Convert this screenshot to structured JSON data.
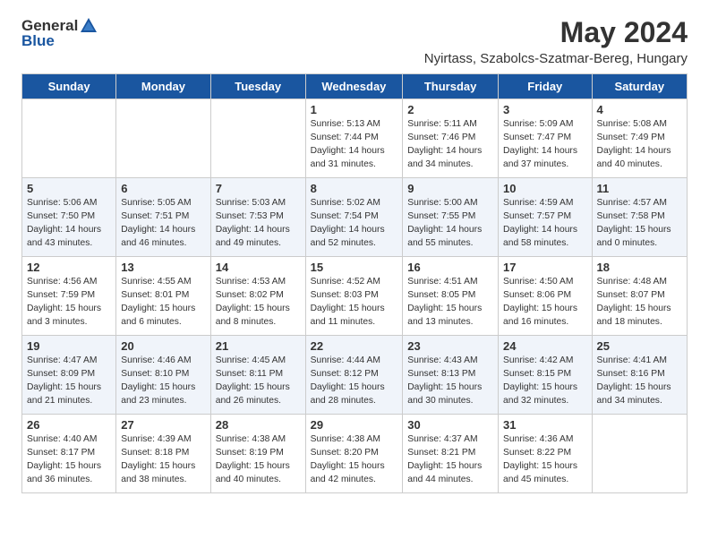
{
  "header": {
    "logo_general": "General",
    "logo_blue": "Blue",
    "month_year": "May 2024",
    "location": "Nyirtass, Szabolcs-Szatmar-Bereg, Hungary"
  },
  "days_of_week": [
    "Sunday",
    "Monday",
    "Tuesday",
    "Wednesday",
    "Thursday",
    "Friday",
    "Saturday"
  ],
  "weeks": [
    {
      "row_class": "row-odd",
      "days": [
        {
          "number": "",
          "empty": true
        },
        {
          "number": "",
          "empty": true
        },
        {
          "number": "",
          "empty": true
        },
        {
          "number": "1",
          "sunrise": "Sunrise: 5:13 AM",
          "sunset": "Sunset: 7:44 PM",
          "daylight": "Daylight: 14 hours and 31 minutes."
        },
        {
          "number": "2",
          "sunrise": "Sunrise: 5:11 AM",
          "sunset": "Sunset: 7:46 PM",
          "daylight": "Daylight: 14 hours and 34 minutes."
        },
        {
          "number": "3",
          "sunrise": "Sunrise: 5:09 AM",
          "sunset": "Sunset: 7:47 PM",
          "daylight": "Daylight: 14 hours and 37 minutes."
        },
        {
          "number": "4",
          "sunrise": "Sunrise: 5:08 AM",
          "sunset": "Sunset: 7:49 PM",
          "daylight": "Daylight: 14 hours and 40 minutes."
        }
      ]
    },
    {
      "row_class": "row-even",
      "days": [
        {
          "number": "5",
          "sunrise": "Sunrise: 5:06 AM",
          "sunset": "Sunset: 7:50 PM",
          "daylight": "Daylight: 14 hours and 43 minutes."
        },
        {
          "number": "6",
          "sunrise": "Sunrise: 5:05 AM",
          "sunset": "Sunset: 7:51 PM",
          "daylight": "Daylight: 14 hours and 46 minutes."
        },
        {
          "number": "7",
          "sunrise": "Sunrise: 5:03 AM",
          "sunset": "Sunset: 7:53 PM",
          "daylight": "Daylight: 14 hours and 49 minutes."
        },
        {
          "number": "8",
          "sunrise": "Sunrise: 5:02 AM",
          "sunset": "Sunset: 7:54 PM",
          "daylight": "Daylight: 14 hours and 52 minutes."
        },
        {
          "number": "9",
          "sunrise": "Sunrise: 5:00 AM",
          "sunset": "Sunset: 7:55 PM",
          "daylight": "Daylight: 14 hours and 55 minutes."
        },
        {
          "number": "10",
          "sunrise": "Sunrise: 4:59 AM",
          "sunset": "Sunset: 7:57 PM",
          "daylight": "Daylight: 14 hours and 58 minutes."
        },
        {
          "number": "11",
          "sunrise": "Sunrise: 4:57 AM",
          "sunset": "Sunset: 7:58 PM",
          "daylight": "Daylight: 15 hours and 0 minutes."
        }
      ]
    },
    {
      "row_class": "row-odd",
      "days": [
        {
          "number": "12",
          "sunrise": "Sunrise: 4:56 AM",
          "sunset": "Sunset: 7:59 PM",
          "daylight": "Daylight: 15 hours and 3 minutes."
        },
        {
          "number": "13",
          "sunrise": "Sunrise: 4:55 AM",
          "sunset": "Sunset: 8:01 PM",
          "daylight": "Daylight: 15 hours and 6 minutes."
        },
        {
          "number": "14",
          "sunrise": "Sunrise: 4:53 AM",
          "sunset": "Sunset: 8:02 PM",
          "daylight": "Daylight: 15 hours and 8 minutes."
        },
        {
          "number": "15",
          "sunrise": "Sunrise: 4:52 AM",
          "sunset": "Sunset: 8:03 PM",
          "daylight": "Daylight: 15 hours and 11 minutes."
        },
        {
          "number": "16",
          "sunrise": "Sunrise: 4:51 AM",
          "sunset": "Sunset: 8:05 PM",
          "daylight": "Daylight: 15 hours and 13 minutes."
        },
        {
          "number": "17",
          "sunrise": "Sunrise: 4:50 AM",
          "sunset": "Sunset: 8:06 PM",
          "daylight": "Daylight: 15 hours and 16 minutes."
        },
        {
          "number": "18",
          "sunrise": "Sunrise: 4:48 AM",
          "sunset": "Sunset: 8:07 PM",
          "daylight": "Daylight: 15 hours and 18 minutes."
        }
      ]
    },
    {
      "row_class": "row-even",
      "days": [
        {
          "number": "19",
          "sunrise": "Sunrise: 4:47 AM",
          "sunset": "Sunset: 8:09 PM",
          "daylight": "Daylight: 15 hours and 21 minutes."
        },
        {
          "number": "20",
          "sunrise": "Sunrise: 4:46 AM",
          "sunset": "Sunset: 8:10 PM",
          "daylight": "Daylight: 15 hours and 23 minutes."
        },
        {
          "number": "21",
          "sunrise": "Sunrise: 4:45 AM",
          "sunset": "Sunset: 8:11 PM",
          "daylight": "Daylight: 15 hours and 26 minutes."
        },
        {
          "number": "22",
          "sunrise": "Sunrise: 4:44 AM",
          "sunset": "Sunset: 8:12 PM",
          "daylight": "Daylight: 15 hours and 28 minutes."
        },
        {
          "number": "23",
          "sunrise": "Sunrise: 4:43 AM",
          "sunset": "Sunset: 8:13 PM",
          "daylight": "Daylight: 15 hours and 30 minutes."
        },
        {
          "number": "24",
          "sunrise": "Sunrise: 4:42 AM",
          "sunset": "Sunset: 8:15 PM",
          "daylight": "Daylight: 15 hours and 32 minutes."
        },
        {
          "number": "25",
          "sunrise": "Sunrise: 4:41 AM",
          "sunset": "Sunset: 8:16 PM",
          "daylight": "Daylight: 15 hours and 34 minutes."
        }
      ]
    },
    {
      "row_class": "row-odd",
      "days": [
        {
          "number": "26",
          "sunrise": "Sunrise: 4:40 AM",
          "sunset": "Sunset: 8:17 PM",
          "daylight": "Daylight: 15 hours and 36 minutes."
        },
        {
          "number": "27",
          "sunrise": "Sunrise: 4:39 AM",
          "sunset": "Sunset: 8:18 PM",
          "daylight": "Daylight: 15 hours and 38 minutes."
        },
        {
          "number": "28",
          "sunrise": "Sunrise: 4:38 AM",
          "sunset": "Sunset: 8:19 PM",
          "daylight": "Daylight: 15 hours and 40 minutes."
        },
        {
          "number": "29",
          "sunrise": "Sunrise: 4:38 AM",
          "sunset": "Sunset: 8:20 PM",
          "daylight": "Daylight: 15 hours and 42 minutes."
        },
        {
          "number": "30",
          "sunrise": "Sunrise: 4:37 AM",
          "sunset": "Sunset: 8:21 PM",
          "daylight": "Daylight: 15 hours and 44 minutes."
        },
        {
          "number": "31",
          "sunrise": "Sunrise: 4:36 AM",
          "sunset": "Sunset: 8:22 PM",
          "daylight": "Daylight: 15 hours and 45 minutes."
        },
        {
          "number": "",
          "empty": true
        }
      ]
    }
  ]
}
